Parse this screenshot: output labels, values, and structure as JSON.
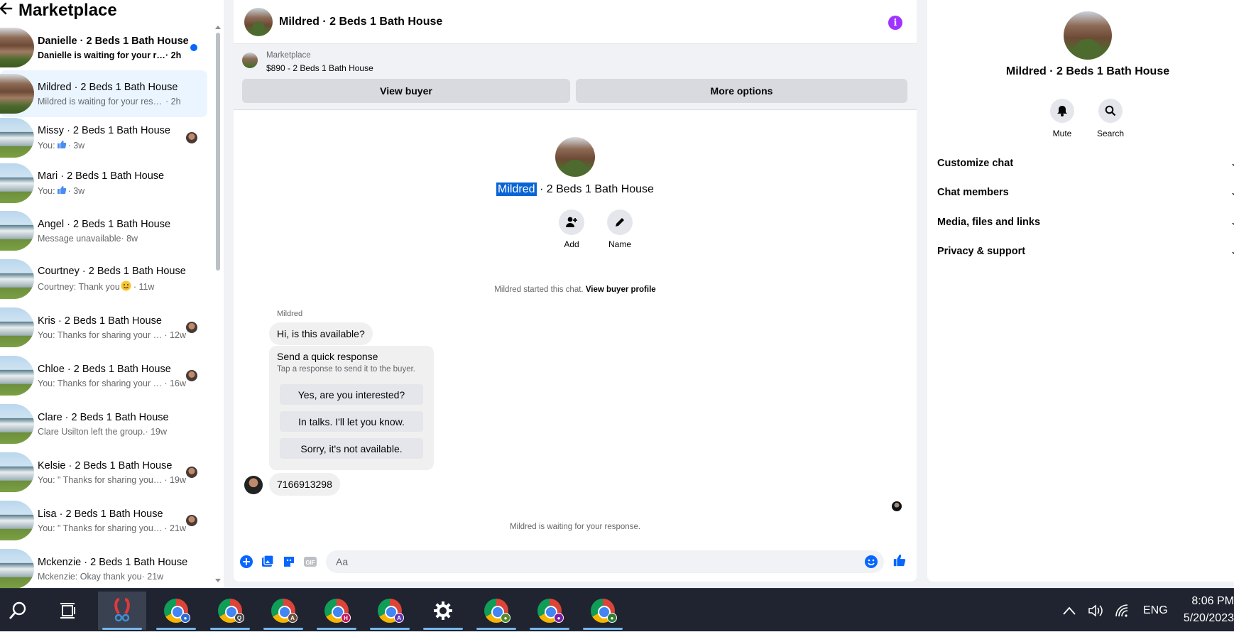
{
  "left": {
    "title": "Marketplace",
    "conversations": [
      {
        "title": "Danielle · 2 Beds 1 Bath House",
        "preview": "Danielle is waiting for your resp...",
        "time": "· 2h",
        "unread": true,
        "thumb": "brick"
      },
      {
        "title": "Mildred · 2 Beds 1 Bath House",
        "preview": "Mildred is waiting for your response.",
        "time": "· 2h",
        "active": true,
        "thumb": "brick"
      },
      {
        "title": "Missy · 2 Beds 1 Bath House",
        "preview": "You: ",
        "time": "· 3w",
        "icon": "thumbs-up",
        "thumb": "blue",
        "read_avatar": true
      },
      {
        "title": "Mari · 2 Beds 1 Bath House",
        "preview": "You: ",
        "time": "· 3w",
        "icon": "thumbs-up",
        "thumb": "blue"
      },
      {
        "title": "Angel · 2 Beds 1 Bath House",
        "preview": "Message unavailable",
        "time": "· 8w",
        "thumb": "blue"
      },
      {
        "title": "Courtney · 2 Beds 1 Bath House",
        "preview": "Courtney: Thank you ",
        "time": "· 11w",
        "icon": "smile-emoji",
        "thumb": "blue"
      },
      {
        "title": "Kris · 2 Beds 1 Bath House",
        "preview": "You: Thanks for sharing your c...",
        "time": "· 12w",
        "thumb": "blue",
        "read_avatar": true
      },
      {
        "title": "Chloe · 2 Beds 1 Bath House",
        "preview": "You: Thanks for sharing your c...",
        "time": "· 16w",
        "thumb": "blue",
        "read_avatar": true
      },
      {
        "title": "Clare · 2 Beds 1 Bath House",
        "preview": "Clare Usilton left the group.",
        "time": "· 19w",
        "thumb": "blue"
      },
      {
        "title": "Kelsie · 2 Beds 1 Bath House",
        "preview": "You: \" Thanks for sharing your ...",
        "time": "· 19w",
        "thumb": "blue",
        "read_avatar": true
      },
      {
        "title": "Lisa · 2 Beds 1 Bath House",
        "preview": "You: \" Thanks for sharing your ...",
        "time": "· 21w",
        "thumb": "blue",
        "read_avatar": true
      },
      {
        "title": "Mckenzie · 2 Beds 1 Bath House",
        "preview": "Mckenzie: Okay thank you",
        "time": "· 21w",
        "thumb": "blue"
      }
    ]
  },
  "chat": {
    "header_title": "Mildred · 2 Beds 1 Bath House",
    "marketplace_label": "Marketplace",
    "listing_price": "$890 - 2 Beds 1 Bath House",
    "view_buyer": "View buyer",
    "more_options": "More options",
    "center_name_highlight": "Mildred",
    "center_name_rest": " · 2 Beds 1 Bath House",
    "add_label": "Add",
    "name_label": "Name",
    "started_text": "Mildred started this chat. ",
    "view_buyer_profile": "View buyer profile",
    "sender_name": "Mildred",
    "first_message": "Hi, is this available?",
    "quick_title": "Send a quick response",
    "quick_sub": "Tap a response to send it to the buyer.",
    "quick_responses": [
      "Yes, are you interested?",
      "In talks. I'll let you know.",
      "Sorry, it's not available."
    ],
    "phone_message": "7166913298",
    "waiting_text": "Mildred is waiting for your response.",
    "composer_placeholder": "Aa"
  },
  "right": {
    "title": "Mildred · 2 Beds 1 Bath House",
    "mute_label": "Mute",
    "search_label": "Search",
    "sections": [
      "Customize chat",
      "Chat members",
      "Media, files and links",
      "Privacy & support"
    ]
  },
  "taskbar": {
    "language": "ENG",
    "time": "8:06 PM",
    "date": "5/20/2023",
    "chrome_badges": [
      "person",
      "Q",
      "A",
      "H",
      "A",
      "settings",
      "person",
      "person",
      "person"
    ]
  },
  "colors": {
    "accent": "#0866ff",
    "info_purple": "#a033ff",
    "highlight": "#0a64d6",
    "taskbar": "#1f2430"
  }
}
